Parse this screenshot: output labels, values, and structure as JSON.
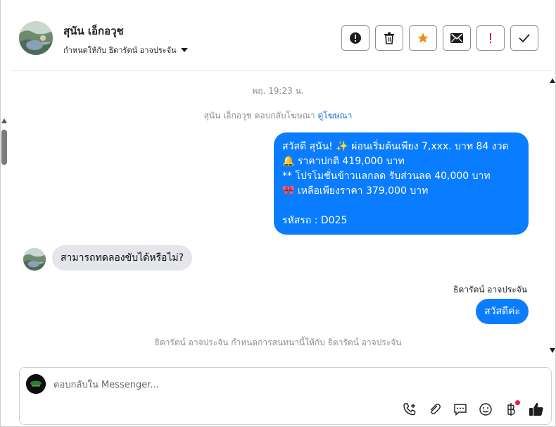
{
  "header": {
    "contact_name": "สุนัน เอ็กอวุช",
    "assigned_to": "กำหนดให้กับ ธิดารัตน์ อาจประจัน",
    "buttons": [
      {
        "name": "report-button",
        "icon": "alert-circle-icon"
      },
      {
        "name": "delete-button",
        "icon": "trash-icon"
      },
      {
        "name": "star-button",
        "icon": "star-icon"
      },
      {
        "name": "mark-unread-button",
        "icon": "envelope-icon"
      },
      {
        "name": "follow-up-button",
        "icon": "exclamation-icon"
      },
      {
        "name": "done-button",
        "icon": "check-icon"
      }
    ]
  },
  "thread": {
    "timestamp": "พฤ. 19:23 น.",
    "ad_reply_text": "สุนัน เอ็กอวุช ตอบกลับโฆษณา",
    "ad_link_text": "ดูโฆษณา",
    "outgoing_1": "สวัสดี สุนัน! ✨  ผ่อนเริ่มต้นเพียง 7,xxx. บาท 84 งวด\n🔔 ราคาปกติ 419,000 บาท\n** โปรโมชั่นข้าวแลกลด รับส่วนลด 40,000 บาท\n🎀  เหลือเพียงราคา 379,000 บาท\n\nรหัสรถ : D025",
    "incoming_1": "สามารถทดลองขับได้หรือไม่?",
    "sender_name": "ธิดารัตน์ อาจประจัน",
    "outgoing_2": "สวัสดีค่ะ",
    "assign_note": "ธิดารัตน์ อาจประจัน กำหนดการสนทนานี้ให้กับ ธิดารัตน์ อาจประจัน"
  },
  "composer": {
    "placeholder": "ตอบกลับใน Messenger...",
    "icons": [
      "phone-add-icon",
      "paperclip-icon",
      "chat-bubble-icon",
      "emoji-icon",
      "baht-icon",
      "thumbs-up-icon"
    ]
  },
  "colors": {
    "accent": "#0a7cff",
    "star": "#f28b1e",
    "alert": "#e41e3f"
  }
}
